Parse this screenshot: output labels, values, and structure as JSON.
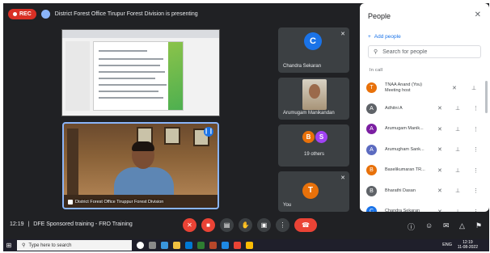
{
  "meet": {
    "rec_label": "REC",
    "presenting_text": "District Forest Office Tirupur Forest Division is presenting",
    "speaker_label": "District Forest Office Tiruppur Forest Division",
    "tiles": [
      {
        "initial": "C",
        "name": "Chandra Sekaran",
        "color": "#1a73e8"
      },
      {
        "initial": "",
        "name": "Arumugam Manikandan",
        "color": ""
      },
      {
        "initial_a": "B",
        "initial_b": "S",
        "name": "19 others",
        "color_a": "#e8710a",
        "color_b": "#a142f4"
      },
      {
        "initial": "T",
        "name": "You",
        "color": "#e8710a"
      }
    ]
  },
  "people_panel": {
    "title": "People",
    "add_people": "Add people",
    "search_placeholder": "Search for people",
    "section": "In call",
    "people": [
      {
        "initial": "T",
        "name": "TNAA Anand (You)",
        "sub": "Meeting host",
        "color": "#e8710a"
      },
      {
        "initial": "A",
        "name": "Adhitni A",
        "sub": "",
        "color": "#5f6368"
      },
      {
        "initial": "A",
        "name": "Arumugam Manik...",
        "sub": "",
        "color": "#7b1fa2"
      },
      {
        "initial": "A",
        "name": "Arumugham Sank...",
        "sub": "",
        "color": "#5c6bc0"
      },
      {
        "initial": "B",
        "name": "Baselikumaran TR...",
        "sub": "",
        "color": "#e8710a"
      },
      {
        "initial": "B",
        "name": "Bharathi Dasan",
        "sub": "",
        "color": "#5f6368"
      },
      {
        "initial": "C",
        "name": "Chandra Sekaran",
        "sub": "",
        "color": "#1a73e8"
      }
    ]
  },
  "bottom": {
    "time": "12:19",
    "separator": "|",
    "meeting_name": "DFE Sponsored training - FRO Training"
  },
  "taskbar": {
    "search_text": "Type here to search",
    "lang": "ENG",
    "time": "12:19",
    "date": "11-08-2022"
  }
}
